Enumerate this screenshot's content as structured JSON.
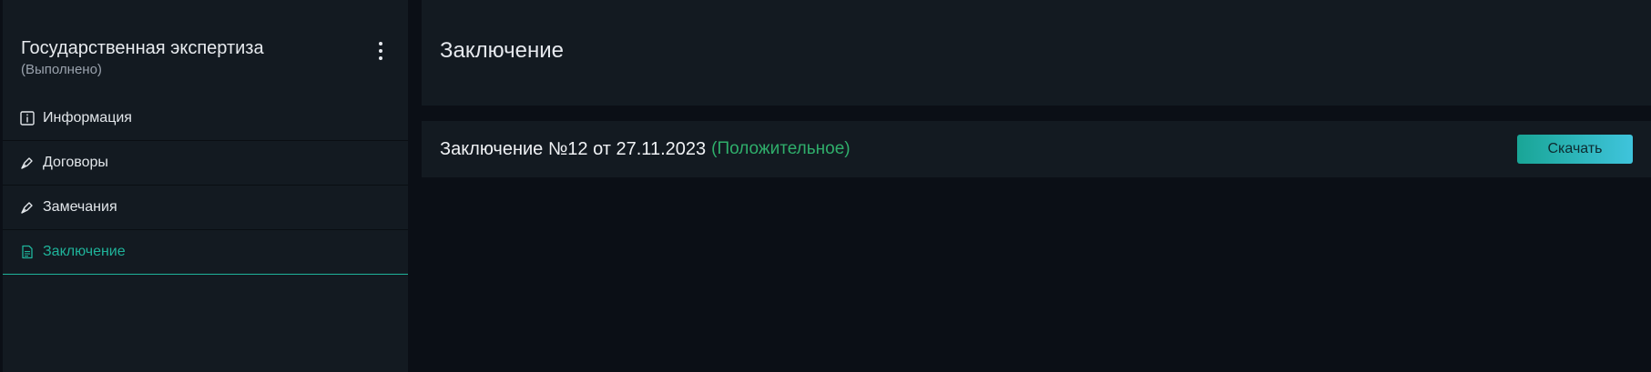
{
  "sidebar": {
    "title": "Государственная экспертиза",
    "subtitle": "(Выполнено)",
    "items": [
      {
        "label": "Информация",
        "icon": "info-icon"
      },
      {
        "label": "Договоры",
        "icon": "pen-icon"
      },
      {
        "label": "Замечания",
        "icon": "pen-icon"
      },
      {
        "label": "Заключение",
        "icon": "document-icon",
        "active": true
      }
    ]
  },
  "main": {
    "title": "Заключение",
    "conclusion": {
      "text": "Заключение №12 от 27.11.2023",
      "status": "(Положительное)",
      "download_label": "Скачать"
    }
  },
  "colors": {
    "accent": "#1fb39a",
    "status_positive": "#2fae6b",
    "panel": "#131a21",
    "background": "#0b0f16"
  }
}
